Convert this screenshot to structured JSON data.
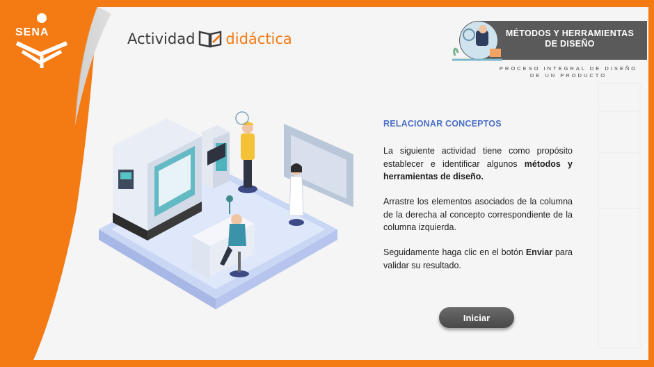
{
  "brand": {
    "logo_text": "SENA"
  },
  "header": {
    "title_part1": "Actividad",
    "title_part2": "didáctica"
  },
  "banner": {
    "title": "MÉTODOS Y HERRAMIENTAS DE DISEÑO",
    "subtitle": "PROCESO INTEGRAL DE DISEÑO DE UN PRODUCTO"
  },
  "content": {
    "section_title": "RELACIONAR CONCEPTOS",
    "p1_text": "La siguiente actividad tiene como propósito establecer e identificar algunos ",
    "p1_bold": "métodos y herramientas de diseño.",
    "p2": "Arrastre los elementos asociados de la columna de la derecha al concepto correspondiente de la columna izquierda.",
    "p3_text": "Seguidamente haga clic en el botón ",
    "p3_bold": "Enviar",
    "p3_end": " para validar su resultado."
  },
  "actions": {
    "start_label": "Iniciar"
  },
  "colors": {
    "brand_orange": "#f47a13",
    "accent_blue": "#4a6fc8",
    "banner_gray": "#5a5a5a"
  }
}
